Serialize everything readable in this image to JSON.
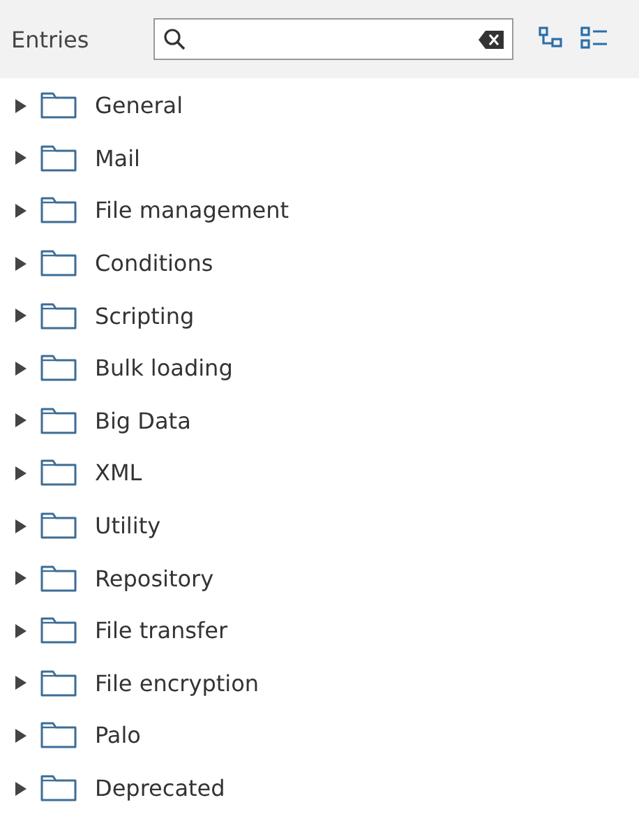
{
  "header": {
    "title": "Entries"
  },
  "tree": [
    {
      "label": "General",
      "expanded": false
    },
    {
      "label": "Mail",
      "expanded": false
    },
    {
      "label": "File management",
      "expanded": false
    },
    {
      "label": "Conditions",
      "expanded": false
    },
    {
      "label": "Scripting",
      "expanded": false
    },
    {
      "label": "Bulk loading",
      "expanded": false
    },
    {
      "label": "Big Data",
      "expanded": false
    },
    {
      "label": "XML",
      "expanded": false
    },
    {
      "label": "Utility",
      "expanded": false
    },
    {
      "label": "Repository",
      "expanded": false
    },
    {
      "label": "File transfer",
      "expanded": false
    },
    {
      "label": "File encryption",
      "expanded": false
    },
    {
      "label": "Palo",
      "expanded": false
    },
    {
      "label": "Deprecated",
      "expanded": false
    }
  ]
}
